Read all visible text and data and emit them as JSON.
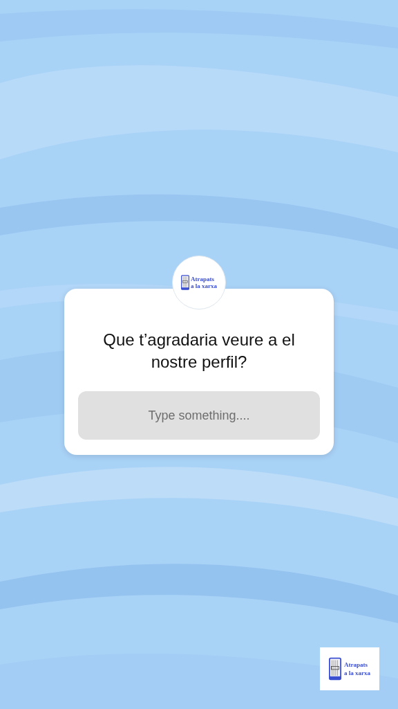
{
  "question_card": {
    "avatar": {
      "logo_lines": [
        "Atrapats",
        "a la xarxa"
      ]
    },
    "question": "Que t’agradaria veure a el nostre perfil?",
    "answer_field": {
      "placeholder": "Type something...."
    }
  },
  "sticker": {
    "logo_lines": [
      "Atrapats",
      "a la xarxa"
    ]
  }
}
